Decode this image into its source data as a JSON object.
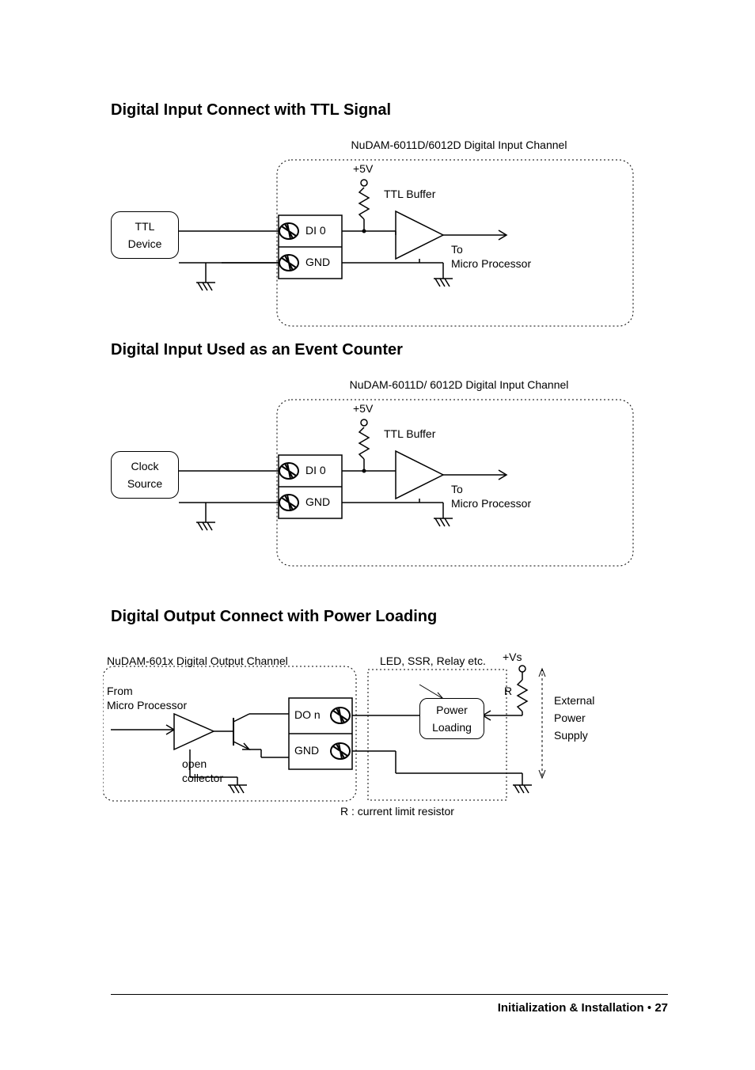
{
  "headings": {
    "h1": "Digital Input Connect with TTL Signal",
    "h2": "Digital Input Used as an Event Counter",
    "h3": "Digital Output Connect with Power Loading"
  },
  "fig1": {
    "caption": "NuDAM-6011D/6012D Digital Input Channel",
    "device_l1": "TTL",
    "device_l2": "Device",
    "di0": "DI 0",
    "gnd": "GND",
    "v5": "+5V",
    "buf": "TTL Buffer",
    "to": "To",
    "mp": "Micro Processor"
  },
  "fig2": {
    "caption": "NuDAM-6011D/ 6012D Digital Input Channel",
    "device_l1": "Clock",
    "device_l2": "Source",
    "di0": "DI 0",
    "gnd": "GND",
    "v5": "+5V",
    "buf": "TTL Buffer",
    "to": "To",
    "mp": "Micro Processor"
  },
  "fig3": {
    "caption": "NuDAM-601x Digital Output Channel",
    "from": "From",
    "mp": "Micro Processor",
    "open": "open",
    "collector": "collector",
    "don": "DO n",
    "gnd": "GND",
    "load_caption": "LED, SSR, Relay etc.",
    "box_l1": "Power",
    "box_l2": "Loading",
    "vs": "+Vs",
    "r": "R",
    "ext1": "External",
    "ext2": "Power",
    "ext3": "Supply",
    "note": "R : current limit resistor"
  },
  "footer": {
    "section": "Initialization & Installation",
    "bullet": " • ",
    "page": "27"
  }
}
